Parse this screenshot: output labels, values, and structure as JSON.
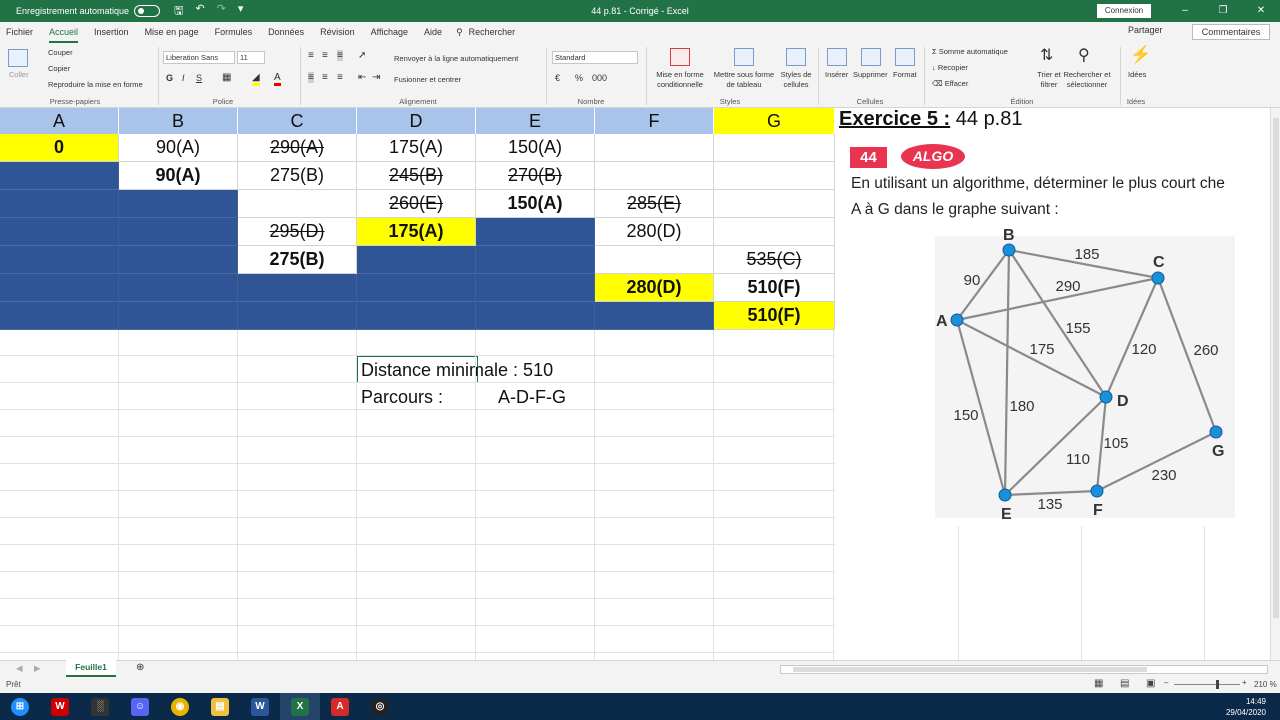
{
  "titlebar": {
    "autosave_label": "Enregistrement automatique",
    "title": "44 p.81 - Corrigé - Excel",
    "signin": "Connexion"
  },
  "ribbon_tabs": [
    "Fichier",
    "Accueil",
    "Insertion",
    "Mise en page",
    "Formules",
    "Données",
    "Révision",
    "Affichage",
    "Aide",
    "Rechercher"
  ],
  "ribbon_actions": {
    "share": "Partager",
    "comments": "Commentaires"
  },
  "ribbon": {
    "clipboard": {
      "paste": "Coller",
      "cut": "Couper",
      "copy": "Copier",
      "format_painter": "Reproduire la mise en forme",
      "label": "Presse-papiers"
    },
    "font": {
      "name": "Liberation Sans",
      "size": "11",
      "label": "Police"
    },
    "alignment": {
      "wrap": "Renvoyer à la ligne automatiquement",
      "merge": "Fusionner et centrer",
      "label": "Alignement"
    },
    "number": {
      "format": "Standard",
      "label": "Nombre"
    },
    "styles": {
      "cond_format": "Mise en forme conditionnelle",
      "table_format": "Mettre sous forme de tableau",
      "cell_styles": "Styles de cellules",
      "label": "Styles"
    },
    "cells": {
      "insert": "Insérer",
      "delete": "Supprimer",
      "format": "Format",
      "label": "Cellules"
    },
    "editing": {
      "autosum": "Somme automatique",
      "fill": "Recopier",
      "clear": "Effacer",
      "sort": "Trier et filtrer",
      "find": "Rechercher et sélectionner",
      "label": "Édition"
    },
    "ideas": {
      "ideas": "Idées",
      "label": "Idées"
    }
  },
  "sheet": {
    "columns": [
      {
        "label": "A",
        "style": "blue"
      },
      {
        "label": "B",
        "style": "blue"
      },
      {
        "label": "C",
        "style": "blue"
      },
      {
        "label": "D",
        "style": "blue"
      },
      {
        "label": "E",
        "style": "blue"
      },
      {
        "label": "F",
        "style": "blue"
      },
      {
        "label": "G",
        "style": "yellow"
      }
    ],
    "rows": [
      [
        {
          "t": "0",
          "s": "yellow bold"
        },
        {
          "t": "90(A)",
          "s": ""
        },
        {
          "t": "290(A)",
          "s": "strike"
        },
        {
          "t": "175(A)",
          "s": ""
        },
        {
          "t": "150(A)",
          "s": ""
        },
        {
          "t": "",
          "s": ""
        },
        {
          "t": "",
          "s": ""
        }
      ],
      [
        {
          "t": "",
          "s": "blue"
        },
        {
          "t": "90(A)",
          "s": "bold"
        },
        {
          "t": "275(B)",
          "s": ""
        },
        {
          "t": "245(B)",
          "s": "strike"
        },
        {
          "t": "270(B)",
          "s": "strike"
        },
        {
          "t": "",
          "s": ""
        },
        {
          "t": "",
          "s": ""
        }
      ],
      [
        {
          "t": "",
          "s": "blue"
        },
        {
          "t": "",
          "s": "blue"
        },
        {
          "t": "",
          "s": ""
        },
        {
          "t": "260(E)",
          "s": "strike"
        },
        {
          "t": "150(A)",
          "s": "bold"
        },
        {
          "t": "285(E)",
          "s": "strike"
        },
        {
          "t": "",
          "s": ""
        }
      ],
      [
        {
          "t": "",
          "s": "blue"
        },
        {
          "t": "",
          "s": "blue"
        },
        {
          "t": "295(D)",
          "s": "strike"
        },
        {
          "t": "175(A)",
          "s": "yellow bold"
        },
        {
          "t": "",
          "s": "blue"
        },
        {
          "t": "280(D)",
          "s": ""
        },
        {
          "t": "",
          "s": ""
        }
      ],
      [
        {
          "t": "",
          "s": "blue"
        },
        {
          "t": "",
          "s": "blue"
        },
        {
          "t": "275(B)",
          "s": "bold"
        },
        {
          "t": "",
          "s": "blue"
        },
        {
          "t": "",
          "s": "blue"
        },
        {
          "t": "",
          "s": ""
        },
        {
          "t": "535(C)",
          "s": "strike"
        }
      ],
      [
        {
          "t": "",
          "s": "blue"
        },
        {
          "t": "",
          "s": "blue"
        },
        {
          "t": "",
          "s": "blue"
        },
        {
          "t": "",
          "s": "blue"
        },
        {
          "t": "",
          "s": "blue"
        },
        {
          "t": "280(D)",
          "s": "yellow bold"
        },
        {
          "t": "510(F)",
          "s": "bold"
        }
      ],
      [
        {
          "t": "",
          "s": "blue"
        },
        {
          "t": "",
          "s": "blue"
        },
        {
          "t": "",
          "s": "blue"
        },
        {
          "t": "",
          "s": "blue"
        },
        {
          "t": "",
          "s": "blue"
        },
        {
          "t": "",
          "s": "blue"
        },
        {
          "t": "510(F)",
          "s": "yellow bold"
        }
      ]
    ],
    "result": {
      "distance_text": "Distance minimale : 510",
      "path_label": "Parcours :",
      "path_value": "A-D-F-G"
    },
    "sheet_tab": "Feuille1"
  },
  "exercise": {
    "title_bold": "Exercice 5 :",
    "title_rest": " 44 p.81",
    "badge": "44",
    "tag": "ALGO",
    "line1": "En utilisant un algorithme, déterminer le plus court che",
    "line2": "A à G dans le graphe suivant :",
    "graph": {
      "nodes": [
        {
          "id": "A"
        },
        {
          "id": "B"
        },
        {
          "id": "C"
        },
        {
          "id": "D"
        },
        {
          "id": "E"
        },
        {
          "id": "F"
        },
        {
          "id": "G"
        }
      ],
      "edges": [
        {
          "from": "A",
          "to": "B",
          "w": "90"
        },
        {
          "from": "B",
          "to": "C",
          "w": "185"
        },
        {
          "from": "A",
          "to": "C",
          "w": "290"
        },
        {
          "from": "B",
          "to": "D",
          "w": "155"
        },
        {
          "from": "A",
          "to": "D",
          "w": "175"
        },
        {
          "from": "C",
          "to": "D",
          "w": "120"
        },
        {
          "from": "C",
          "to": "G",
          "w": "260"
        },
        {
          "from": "A",
          "to": "E",
          "w": "150"
        },
        {
          "from": "B",
          "to": "E",
          "w": "180"
        },
        {
          "from": "D",
          "to": "E",
          "w": "110"
        },
        {
          "from": "D",
          "to": "F",
          "w": "105"
        },
        {
          "from": "E",
          "to": "F",
          "w": "135"
        },
        {
          "from": "F",
          "to": "G",
          "w": "230"
        }
      ]
    }
  },
  "status": {
    "ready": "Prêt",
    "zoom": "210 %"
  },
  "taskbar": {
    "time": "14:49",
    "date": "29/04/2020"
  },
  "colors": {
    "excel_green": "#217346",
    "header_blue": "#a9c4eb",
    "fill_blue": "#2f5597",
    "highlight": "#ffff00",
    "node": "#1c8fd9"
  }
}
